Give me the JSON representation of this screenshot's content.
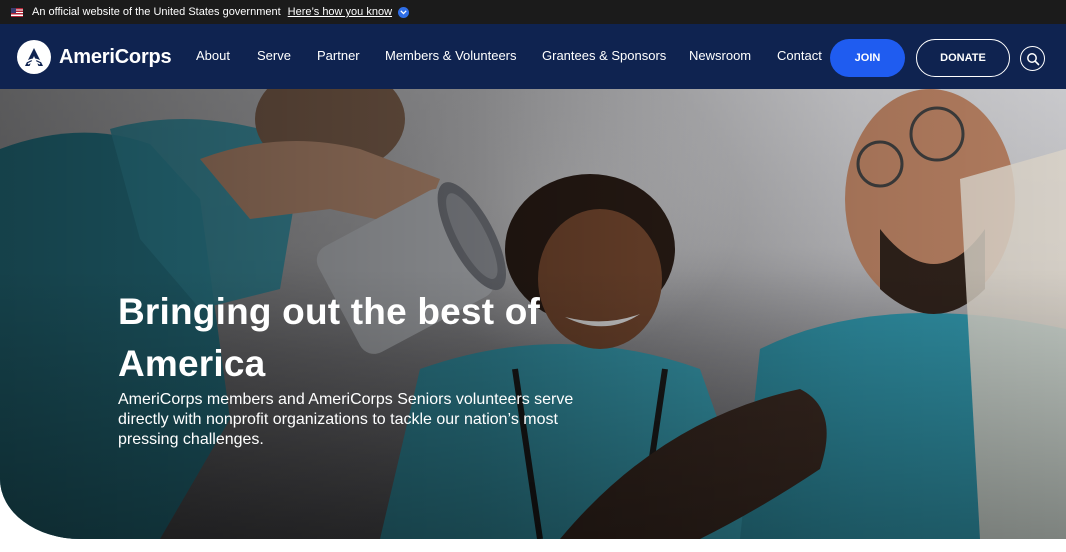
{
  "gov_banner": {
    "text": "An official website of the United States government",
    "link": "Here’s how you know"
  },
  "header": {
    "logo_text": "AmeriCorps",
    "nav": [
      {
        "label": "About"
      },
      {
        "label": "Serve"
      },
      {
        "label": "Partner"
      },
      {
        "label": "Members & Volunteers"
      },
      {
        "label": "Grantees & Sponsors"
      },
      {
        "label": "Newsroom"
      },
      {
        "label": "Contact"
      }
    ],
    "join_label": "JOIN",
    "donate_label": "DONATE"
  },
  "hero": {
    "title": "Bringing out the best of America",
    "subtitle": "AmeriCorps members and AmeriCorps Seniors volunteers serve directly with nonprofit organizations to tackle our nation’s most pressing challenges."
  },
  "colors": {
    "gov_banner_bg": "#1b1b1b",
    "header_bg": "#0f2350",
    "join_bg": "#1f5cf0",
    "scrub_teal": "#3aa3b8"
  },
  "icons": {
    "flag": "us-flag-icon",
    "chevron": "chevron-down-icon",
    "logo": "americorps-logo-icon",
    "search": "search-icon"
  }
}
